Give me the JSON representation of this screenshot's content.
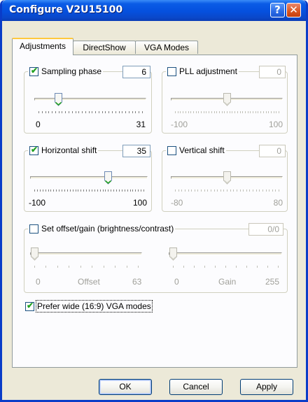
{
  "window": {
    "title": "Configure V2U15100",
    "help_label": "?",
    "close_label": "✕"
  },
  "tabs": [
    {
      "label": "Adjustments",
      "active": true
    },
    {
      "label": "DirectShow",
      "active": false
    },
    {
      "label": "VGA Modes",
      "active": false
    }
  ],
  "sampling_phase": {
    "label": "Sampling phase",
    "checked": true,
    "value": "6",
    "min": "0",
    "max": "31",
    "level": 6
  },
  "pll_adjustment": {
    "label": "PLL adjustment",
    "checked": false,
    "value": "0",
    "min": "-100",
    "max": "100",
    "level": 0
  },
  "horizontal_shift": {
    "label": "Horizontal shift",
    "checked": true,
    "value": "35",
    "min": "-100",
    "max": "100",
    "level": 35
  },
  "vertical_shift": {
    "label": "Vertical shift",
    "checked": false,
    "value": "0",
    "min": "-80",
    "max": "80",
    "level": 0
  },
  "offset_gain": {
    "label": "Set offset/gain (brightness/contrast)",
    "checked": false,
    "value": "0/0",
    "offset": {
      "min": "0",
      "name": "Offset",
      "max": "63",
      "level": 0
    },
    "gain": {
      "min": "0",
      "name": "Gain",
      "max": "255",
      "level": 0
    }
  },
  "prefer_wide": {
    "label": "Prefer wide (16:9) VGA modes",
    "checked": true
  },
  "buttons": {
    "ok": "OK",
    "cancel": "Cancel",
    "apply": "Apply"
  },
  "colors": {
    "title_bar": "#0a5be6",
    "check": "#21a121",
    "dialog_bg": "#ece9d8",
    "panel_bg": "#fcfcfe"
  },
  "icons": {
    "help": "help-icon",
    "close": "close-icon",
    "check": "check-icon",
    "thumb": "slider-thumb-icon"
  }
}
